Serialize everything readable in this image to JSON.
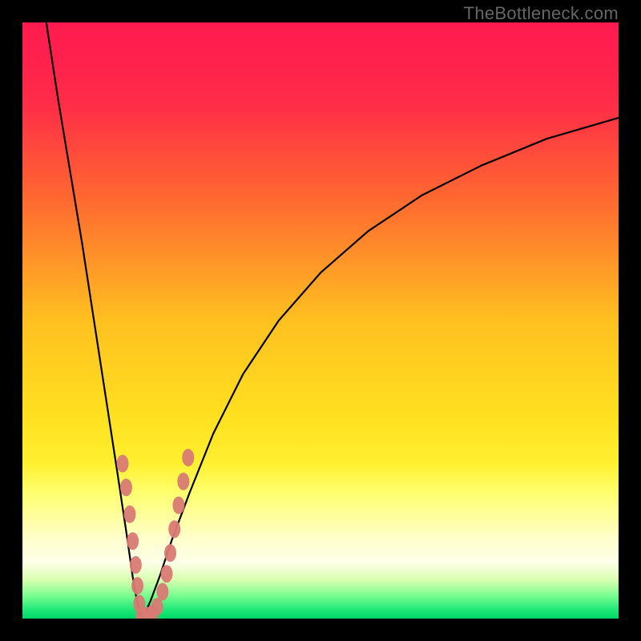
{
  "watermark": "TheBottleneck.com",
  "chart_data": {
    "type": "line",
    "title": "",
    "xlabel": "",
    "ylabel": "",
    "xlim": [
      0,
      100
    ],
    "ylim": [
      0,
      100
    ],
    "gradient_stops": [
      {
        "pos": 0.0,
        "color": "#ff1a50"
      },
      {
        "pos": 0.13,
        "color": "#ff2a48"
      },
      {
        "pos": 0.3,
        "color": "#ff6a30"
      },
      {
        "pos": 0.5,
        "color": "#ffc020"
      },
      {
        "pos": 0.66,
        "color": "#ffe020"
      },
      {
        "pos": 0.74,
        "color": "#fff030"
      },
      {
        "pos": 0.79,
        "color": "#ffff70"
      },
      {
        "pos": 0.83,
        "color": "#ffffa0"
      },
      {
        "pos": 0.87,
        "color": "#ffffd0"
      },
      {
        "pos": 0.905,
        "color": "#ffffe8"
      },
      {
        "pos": 0.935,
        "color": "#d8ffb0"
      },
      {
        "pos": 0.96,
        "color": "#80ff90"
      },
      {
        "pos": 0.985,
        "color": "#20e878"
      },
      {
        "pos": 1.0,
        "color": "#00d868"
      }
    ],
    "series": [
      {
        "name": "left-branch",
        "x": [
          4,
          6,
          8,
          10,
          12,
          14,
          16,
          17.5,
          18.5,
          19.2,
          19.7,
          20.0
        ],
        "y": [
          100,
          87,
          75,
          63,
          50,
          37,
          24,
          14,
          7,
          3,
          1,
          0
        ]
      },
      {
        "name": "right-branch",
        "x": [
          20.0,
          20.6,
          21.5,
          23,
          25,
          28,
          32,
          37,
          43,
          50,
          58,
          67,
          77,
          88,
          100
        ],
        "y": [
          0,
          1,
          3,
          7,
          13,
          21,
          31,
          41,
          50,
          58,
          65,
          71,
          76,
          80.5,
          84
        ]
      }
    ],
    "markers": {
      "name": "data-points",
      "color": "#d97a74",
      "points": [
        {
          "x": 16.8,
          "y": 26
        },
        {
          "x": 17.4,
          "y": 22
        },
        {
          "x": 18.0,
          "y": 17.5
        },
        {
          "x": 18.5,
          "y": 13
        },
        {
          "x": 19.0,
          "y": 9
        },
        {
          "x": 19.3,
          "y": 5.5
        },
        {
          "x": 19.6,
          "y": 2.5
        },
        {
          "x": 20.0,
          "y": 0.5
        },
        {
          "x": 20.9,
          "y": 0.5
        },
        {
          "x": 21.8,
          "y": 0.8
        },
        {
          "x": 22.6,
          "y": 2.0
        },
        {
          "x": 23.5,
          "y": 4.5
        },
        {
          "x": 24.2,
          "y": 7.5
        },
        {
          "x": 24.8,
          "y": 11
        },
        {
          "x": 25.5,
          "y": 15
        },
        {
          "x": 26.2,
          "y": 19
        },
        {
          "x": 27.0,
          "y": 23
        },
        {
          "x": 27.8,
          "y": 27
        }
      ]
    }
  }
}
